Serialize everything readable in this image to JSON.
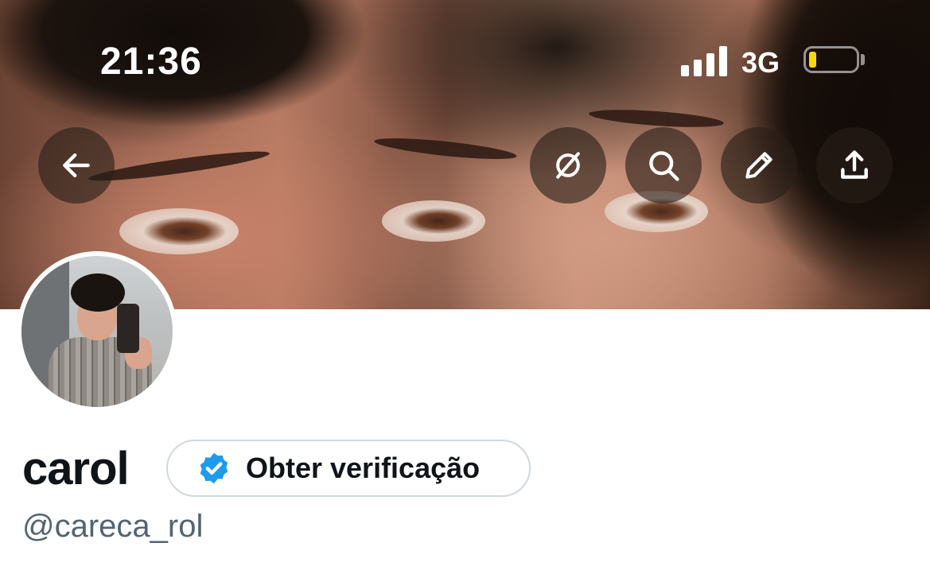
{
  "status_bar": {
    "time": "21:36",
    "network": "3G",
    "battery_level_percent": 10,
    "signal_bars": 4
  },
  "header_buttons": {
    "back": "back-arrow-icon",
    "grok": "grok-icon",
    "search": "search-icon",
    "edit": "pencil-icon",
    "share": "share-icon"
  },
  "profile": {
    "display_name": "carol",
    "handle": "@careca_rol",
    "verify_button_label": "Obter verificação"
  },
  "colors": {
    "verified_badge": "#1d9bf0",
    "text_primary": "#0f1419",
    "text_secondary": "#536471",
    "battery_low": "#ffd60a"
  }
}
